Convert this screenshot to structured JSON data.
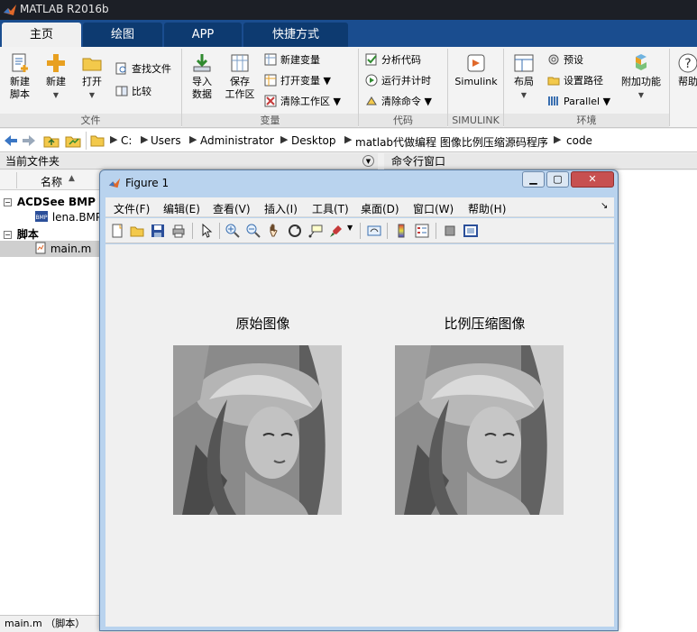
{
  "window": {
    "title": "MATLAB R2016b"
  },
  "tabs": [
    {
      "label": "主页",
      "active": true
    },
    {
      "label": "绘图"
    },
    {
      "label": "APP"
    },
    {
      "label": "快捷方式"
    }
  ],
  "ribbon": {
    "new_script": [
      "新建",
      "脚本"
    ],
    "new": "新建",
    "open": "打开",
    "find_files": "查找文件",
    "compare": "比较",
    "import_data": [
      "导入",
      "数据"
    ],
    "save_workspace": [
      "保存",
      "工作区"
    ],
    "new_variable": "新建变量",
    "open_variable": "打开变量",
    "clear_workspace": "清除工作区",
    "analyze_code": "分析代码",
    "run_and_time": "运行并计时",
    "clear_commands": "清除命令",
    "simulink": "Simulink",
    "layout": "布局",
    "preferences": "预设",
    "set_path": "设置路径",
    "parallel": "Parallel",
    "add_ons": "附加功能",
    "help": "帮助",
    "groups": {
      "file": "文件",
      "variable": "变量",
      "code": "代码",
      "simulink": "SIMULINK",
      "environment": "环境"
    }
  },
  "address": [
    "C:",
    "Users",
    "Administrator",
    "Desktop",
    "matlab代做编程 图像比例压缩源码程序",
    "code"
  ],
  "panels": {
    "current_folder": "当前文件夹",
    "command_window": "命令行窗口",
    "name_column": "名称",
    "sort_indicator": "▲"
  },
  "file_tree": {
    "group1": "ACDSee BMP 图",
    "file1": "lena.BMP",
    "group2": "脚本",
    "file2": "main.m"
  },
  "status": "main.m （脚本）",
  "figure": {
    "title": "Figure 1",
    "menus": [
      "文件(F)",
      "编辑(E)",
      "查看(V)",
      "插入(I)",
      "工具(T)",
      "桌面(D)",
      "窗口(W)",
      "帮助(H)"
    ],
    "left_title": "原始图像",
    "right_title": "比例压缩图像"
  },
  "colors": {
    "tab_bar": "#1a4d8f",
    "title_bar": "#1c1f26",
    "figure_frame": "#b9d3ee",
    "accent_orange": "#e8a020"
  }
}
